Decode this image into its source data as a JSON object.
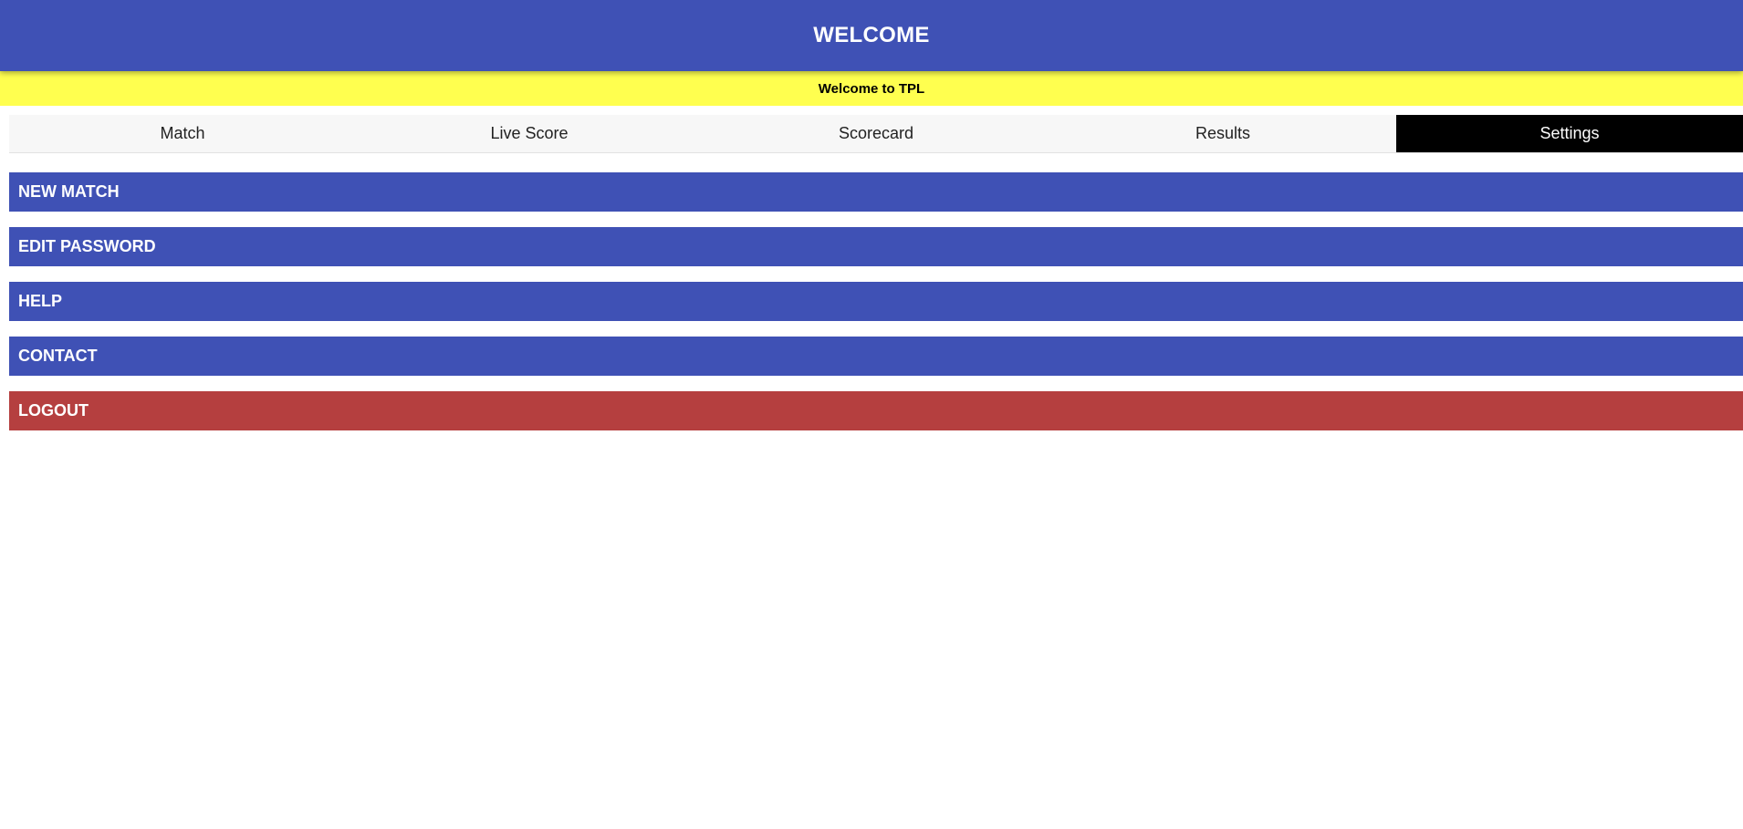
{
  "header": {
    "title": "WELCOME",
    "color": "#3f51b5"
  },
  "marquee": {
    "text": "Welcome to TPL",
    "color": "#ffff4f"
  },
  "tabs": [
    {
      "label": "Match",
      "active": false
    },
    {
      "label": "Live Score",
      "active": false
    },
    {
      "label": "Scorecard",
      "active": false
    },
    {
      "label": "Results",
      "active": false
    },
    {
      "label": "Settings",
      "active": true
    }
  ],
  "settings_menu": [
    {
      "label": "NEW MATCH",
      "color": "#3f51b5"
    },
    {
      "label": "EDIT PASSWORD",
      "color": "#3f51b5"
    },
    {
      "label": "HELP",
      "color": "#3f51b5"
    },
    {
      "label": "CONTACT",
      "color": "#3f51b5"
    },
    {
      "label": "LOGOUT",
      "color": "#b53f3f"
    }
  ]
}
